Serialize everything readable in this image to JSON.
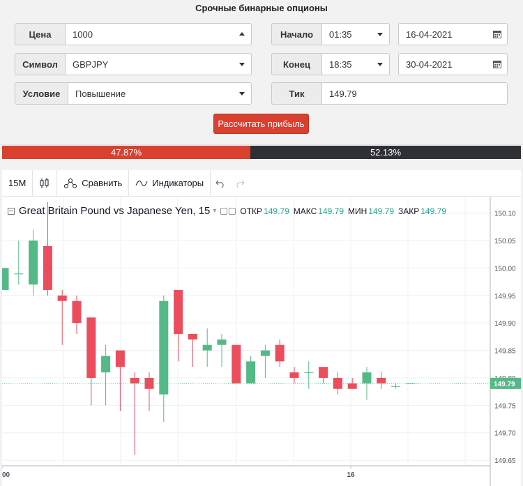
{
  "title": "Срочные бинарные опционы",
  "form": {
    "price_label": "Цена",
    "price_value": "1000",
    "symbol_label": "Символ",
    "symbol_value": "GBPJPY",
    "condition_label": "Условие",
    "condition_value": "Повышение",
    "start_label": "Начало",
    "start_time": "01:35",
    "start_date": "16-04-2021",
    "end_label": "Конец",
    "end_time": "18:35",
    "end_date": "30-04-2021",
    "tick_label": "Тик",
    "tick_value": "149.79",
    "calc_button": "Рассчитать прибыль"
  },
  "ratio": {
    "up_percent": "47.87%",
    "down_percent": "52.13%",
    "up_fraction": 0.4787
  },
  "toolbar": {
    "interval": "15M",
    "compare": "Сравнить",
    "indicators": "Индикаторы"
  },
  "legend": {
    "symbol_name": "Great Britain Pound vs Japanese Yen, 15",
    "open_label": "ОТКР",
    "open_value": "149.79",
    "high_label": "МАКС",
    "high_value": "149.79",
    "low_label": "МИН",
    "low_value": "149.79",
    "close_label": "ЗАКР",
    "close_value": "149.79"
  },
  "colors": {
    "up": "#53b987",
    "down": "#eb4d5c",
    "accent": "#d9402f",
    "dark": "#2f3035"
  },
  "chart_data": {
    "type": "candlestick",
    "y_ticks": [
      "150.10",
      "150.05",
      "150.00",
      "149.95",
      "149.90",
      "149.85",
      "149.80",
      "149.75",
      "149.70",
      "149.65"
    ],
    "ylim": [
      149.64,
      150.13
    ],
    "x_ticks": [
      "00",
      "16"
    ],
    "last_price": "149.79",
    "candles": [
      {
        "o": 149.96,
        "h": 150.0,
        "l": 149.96,
        "c": 150.0
      },
      {
        "o": 149.99,
        "h": 150.05,
        "l": 149.97,
        "c": 149.99
      },
      {
        "o": 149.97,
        "h": 150.07,
        "l": 149.95,
        "c": 150.05
      },
      {
        "o": 150.04,
        "h": 150.12,
        "l": 149.95,
        "c": 149.96
      },
      {
        "o": 149.95,
        "h": 149.96,
        "l": 149.86,
        "c": 149.94
      },
      {
        "o": 149.94,
        "h": 149.95,
        "l": 149.88,
        "c": 149.9
      },
      {
        "o": 149.91,
        "h": 149.91,
        "l": 149.75,
        "c": 149.8
      },
      {
        "o": 149.81,
        "h": 149.86,
        "l": 149.75,
        "c": 149.84
      },
      {
        "o": 149.85,
        "h": 149.85,
        "l": 149.74,
        "c": 149.82
      },
      {
        "o": 149.8,
        "h": 149.81,
        "l": 149.66,
        "c": 149.79
      },
      {
        "o": 149.8,
        "h": 149.81,
        "l": 149.74,
        "c": 149.78
      },
      {
        "o": 149.77,
        "h": 149.95,
        "l": 149.72,
        "c": 149.94
      },
      {
        "o": 149.96,
        "h": 149.96,
        "l": 149.83,
        "c": 149.88
      },
      {
        "o": 149.88,
        "h": 149.88,
        "l": 149.82,
        "c": 149.87
      },
      {
        "o": 149.85,
        "h": 149.89,
        "l": 149.82,
        "c": 149.86
      },
      {
        "o": 149.86,
        "h": 149.88,
        "l": 149.82,
        "c": 149.87
      },
      {
        "o": 149.86,
        "h": 149.86,
        "l": 149.79,
        "c": 149.79
      },
      {
        "o": 149.79,
        "h": 149.84,
        "l": 149.79,
        "c": 149.83
      },
      {
        "o": 149.84,
        "h": 149.86,
        "l": 149.8,
        "c": 149.85
      },
      {
        "o": 149.86,
        "h": 149.87,
        "l": 149.82,
        "c": 149.83
      },
      {
        "o": 149.81,
        "h": 149.82,
        "l": 149.79,
        "c": 149.8
      },
      {
        "o": 149.81,
        "h": 149.83,
        "l": 149.78,
        "c": 149.81
      },
      {
        "o": 149.82,
        "h": 149.82,
        "l": 149.79,
        "c": 149.8
      },
      {
        "o": 149.8,
        "h": 149.81,
        "l": 149.77,
        "c": 149.78
      },
      {
        "o": 149.79,
        "h": 149.8,
        "l": 149.78,
        "c": 149.78
      },
      {
        "o": 149.79,
        "h": 149.82,
        "l": 149.76,
        "c": 149.81
      },
      {
        "o": 149.8,
        "h": 149.81,
        "l": 149.78,
        "c": 149.79
      },
      {
        "o": 149.785,
        "h": 149.79,
        "l": 149.78,
        "c": 149.785
      },
      {
        "o": 149.79,
        "h": 149.79,
        "l": 149.79,
        "c": 149.79
      }
    ]
  }
}
